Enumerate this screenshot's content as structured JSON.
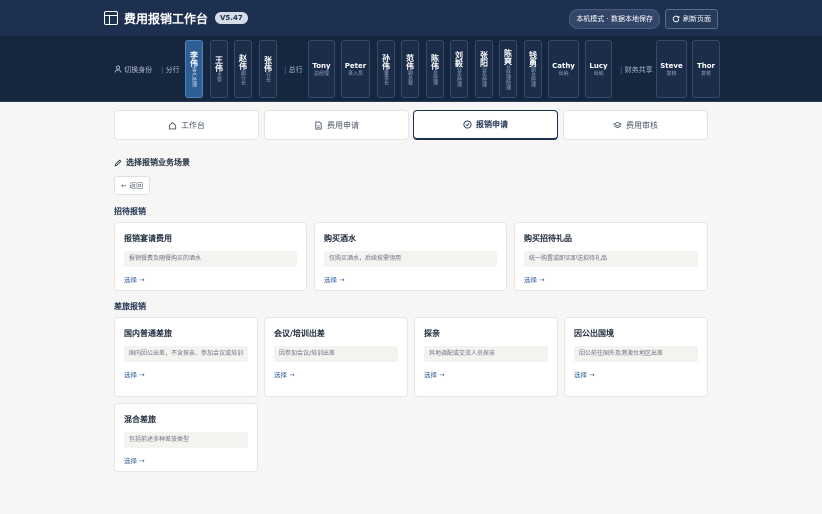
{
  "header": {
    "title": "费用报销工作台",
    "version": "V5.47",
    "mode_badge": "本机模式 · 数据本地保存",
    "refresh_label": "刷新页面"
  },
  "rolebar": {
    "switch_label": "切换身份",
    "branch_label": "分行",
    "head_label": "总行",
    "shared_label": "财务共享",
    "roles": [
      {
        "name": "李伟",
        "role": "客户经理",
        "active": true
      },
      {
        "name": "王伟",
        "role": "主管"
      },
      {
        "name": "赵伟",
        "role": "副行长"
      },
      {
        "name": "张伟",
        "role": "行长"
      },
      {
        "name": "Tony",
        "role": "总经理"
      },
      {
        "name": "Peter",
        "role": "录入员"
      },
      {
        "name": "孙伟",
        "role": "董事长"
      },
      {
        "name": "范伟",
        "role": "副总裁"
      },
      {
        "name": "陈伟",
        "role": "总经理"
      },
      {
        "name": "刘毅",
        "role": "业务经理"
      },
      {
        "name": "张阳",
        "role": "业务经理"
      },
      {
        "name": "陈爽",
        "role": "总经理助理"
      },
      {
        "name": "钱勇",
        "role": "副总经理"
      },
      {
        "name": "Cathy",
        "role": "出纳"
      },
      {
        "name": "Lucy",
        "role": "出纳"
      },
      {
        "name": "Steve",
        "role": "复核"
      },
      {
        "name": "Thor",
        "role": "复核"
      }
    ]
  },
  "tabs": [
    {
      "label": "工作台",
      "icon": "home-icon"
    },
    {
      "label": "费用申请",
      "icon": "document-icon"
    },
    {
      "label": "报销申请",
      "icon": "check-circle-icon",
      "active": true
    },
    {
      "label": "费用审核",
      "icon": "stack-icon"
    }
  ],
  "main": {
    "section_title": "选择报销业务场景",
    "back_label": "← 返回",
    "groups": [
      {
        "title": "招待报销",
        "cards": [
          {
            "title": "报销宴请费用",
            "desc": "报销餐费及随餐购买的酒水",
            "link": "选择 →"
          },
          {
            "title": "购买酒水",
            "desc": "仅购买酒水，后续按需领用",
            "link": "选择 →"
          },
          {
            "title": "购买招待礼品",
            "desc": "统一购置或即买即送招待礼品",
            "link": "选择 →"
          }
        ]
      },
      {
        "title": "差旅报销",
        "cards": [
          {
            "title": "国内普通差旅",
            "desc": "国内因公出差，不含探亲、参加会议或培训",
            "link": "选择 →"
          },
          {
            "title": "会议/培训出差",
            "desc": "因参加会议/培训出差",
            "link": "选择 →"
          },
          {
            "title": "探亲",
            "desc": "异地调配或交流人员探亲",
            "link": "选择 →"
          },
          {
            "title": "因公出国境",
            "desc": "因公前往国外及港澳台地区出差",
            "link": "选择 →"
          },
          {
            "title": "混合差旅",
            "desc": "包括前述多种差旅类型",
            "link": "选择 →"
          }
        ]
      }
    ]
  }
}
